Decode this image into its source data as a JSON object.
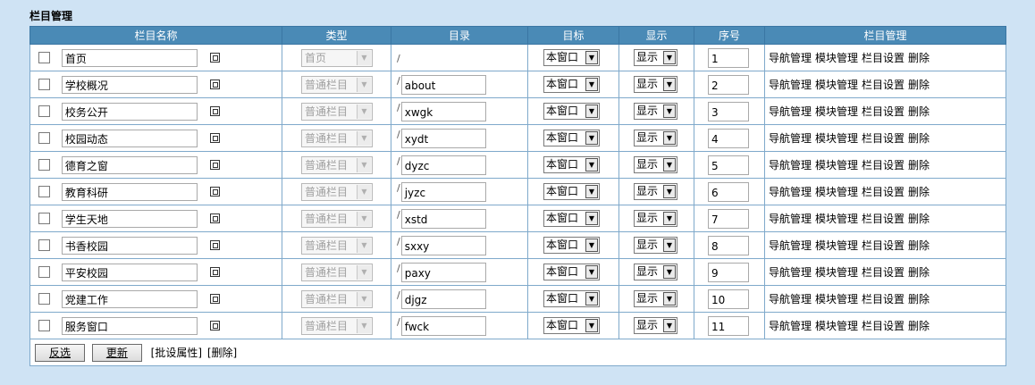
{
  "page": {
    "title": "栏目管理"
  },
  "headers": [
    "栏目名称",
    "类型",
    "目录",
    "目标",
    "显示",
    "序号",
    "栏目管理"
  ],
  "rows": [
    {
      "name": "首页",
      "type": "首页",
      "dir": "",
      "target": "本窗口",
      "show": "显示",
      "order": "1"
    },
    {
      "name": "学校概况",
      "type": "普通栏目",
      "dir": "about",
      "target": "本窗口",
      "show": "显示",
      "order": "2"
    },
    {
      "name": "校务公开",
      "type": "普通栏目",
      "dir": "xwgk",
      "target": "本窗口",
      "show": "显示",
      "order": "3"
    },
    {
      "name": "校园动态",
      "type": "普通栏目",
      "dir": "xydt",
      "target": "本窗口",
      "show": "显示",
      "order": "4"
    },
    {
      "name": "德育之窗",
      "type": "普通栏目",
      "dir": "dyzc",
      "target": "本窗口",
      "show": "显示",
      "order": "5"
    },
    {
      "name": "教育科研",
      "type": "普通栏目",
      "dir": "jyzc",
      "target": "本窗口",
      "show": "显示",
      "order": "6"
    },
    {
      "name": "学生天地",
      "type": "普通栏目",
      "dir": "xstd",
      "target": "本窗口",
      "show": "显示",
      "order": "7"
    },
    {
      "name": "书香校园",
      "type": "普通栏目",
      "dir": "sxxy",
      "target": "本窗口",
      "show": "显示",
      "order": "8"
    },
    {
      "name": "平安校园",
      "type": "普通栏目",
      "dir": "paxy",
      "target": "本窗口",
      "show": "显示",
      "order": "9"
    },
    {
      "name": "党建工作",
      "type": "普通栏目",
      "dir": "djgz",
      "target": "本窗口",
      "show": "显示",
      "order": "10"
    },
    {
      "name": "服务窗口",
      "type": "普通栏目",
      "dir": "fwck",
      "target": "本窗口",
      "show": "显示",
      "order": "11"
    }
  ],
  "dir_prefix": "/",
  "row_links": [
    "导航管理",
    "模块管理",
    "栏目设置",
    "删除"
  ],
  "footer": {
    "invert_label": "反选",
    "update_label": "更新",
    "batch_label": "[批设属性]",
    "delete_label": "[删除]"
  }
}
